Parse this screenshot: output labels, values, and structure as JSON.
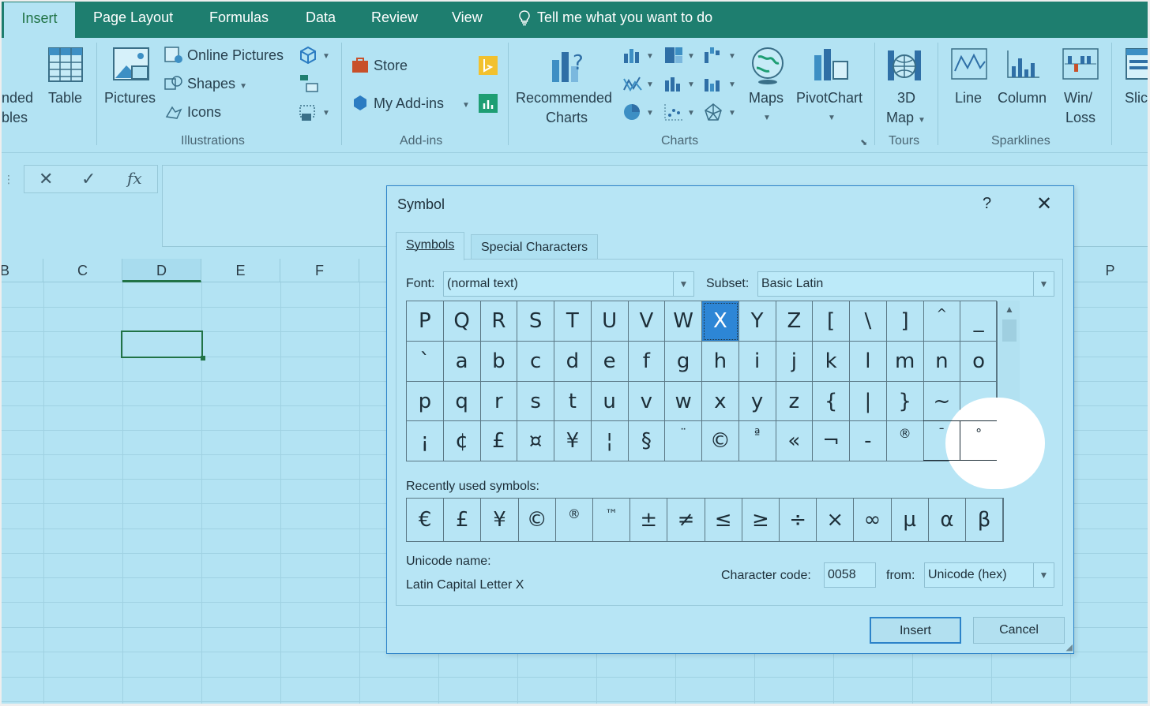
{
  "ribbon_tabs": [
    "Insert",
    "Page Layout",
    "Formulas",
    "Data",
    "Review",
    "View"
  ],
  "tell_me": "Tell me what you want to do",
  "ribbon": {
    "tables": {
      "partial_top": "nded",
      "partial_bottom": "bles",
      "table": "Table"
    },
    "illustrations": {
      "pictures": "Pictures",
      "online_pictures": "Online Pictures",
      "shapes": "Shapes",
      "icons": "Icons",
      "group": "Illustrations"
    },
    "addins": {
      "store": "Store",
      "my_addins": "My Add-ins",
      "group": "Add-ins"
    },
    "charts": {
      "recommended_1": "Recommended",
      "recommended_2": "Charts",
      "maps": "Maps",
      "pivotchart": "PivotChart",
      "group": "Charts"
    },
    "tours": {
      "map_1": "3D",
      "map_2": "Map",
      "group": "Tours"
    },
    "sparklines": {
      "line": "Line",
      "column": "Column",
      "winloss_1": "Win/",
      "winloss_2": "Loss",
      "group": "Sparklines"
    },
    "slicer_partial": "Slic"
  },
  "formula_bar": {
    "cancel": "✕",
    "enter": "✓",
    "fx": "fx"
  },
  "columns": [
    "B",
    "C",
    "D",
    "E",
    "F",
    "P"
  ],
  "dialog": {
    "title": "Symbol",
    "help": "?",
    "close": "✕",
    "tabs": [
      "Symbols",
      "Special Characters"
    ],
    "font_label": "Font:",
    "font_value": "(normal text)",
    "subset_label": "Subset:",
    "subset_value": "Basic Latin",
    "symbol_rows": [
      [
        "P",
        "Q",
        "R",
        "S",
        "T",
        "U",
        "V",
        "W",
        "X",
        "Y",
        "Z",
        "[",
        "\\",
        "]",
        "^",
        "_"
      ],
      [
        "`",
        "a",
        "b",
        "c",
        "d",
        "e",
        "f",
        "g",
        "h",
        "i",
        "j",
        "k",
        "l",
        "m",
        "n",
        "o"
      ],
      [
        "p",
        "q",
        "r",
        "s",
        "t",
        "u",
        "v",
        "w",
        "x",
        "y",
        "z",
        "{",
        "|",
        "}",
        "~",
        ""
      ],
      [
        "¡",
        "¢",
        "£",
        "¤",
        "¥",
        "¦",
        "§",
        "¨",
        "©",
        "ª",
        "«",
        "¬",
        "-",
        "®",
        "¯",
        "°"
      ]
    ],
    "selected_symbol": "X",
    "recent_label": "Recently used symbols:",
    "recent_symbols": [
      "€",
      "£",
      "¥",
      "©",
      "®",
      "™",
      "±",
      "≠",
      "≤",
      "≥",
      "÷",
      "×",
      "∞",
      "µ",
      "α",
      "β"
    ],
    "unicode_name_label": "Unicode name:",
    "unicode_name_value": "Latin Capital Letter X",
    "char_code_label": "Character code:",
    "char_code_value": "0058",
    "from_label": "from:",
    "from_value": "Unicode (hex)",
    "insert_label": "Insert",
    "cancel_label": "Cancel"
  }
}
